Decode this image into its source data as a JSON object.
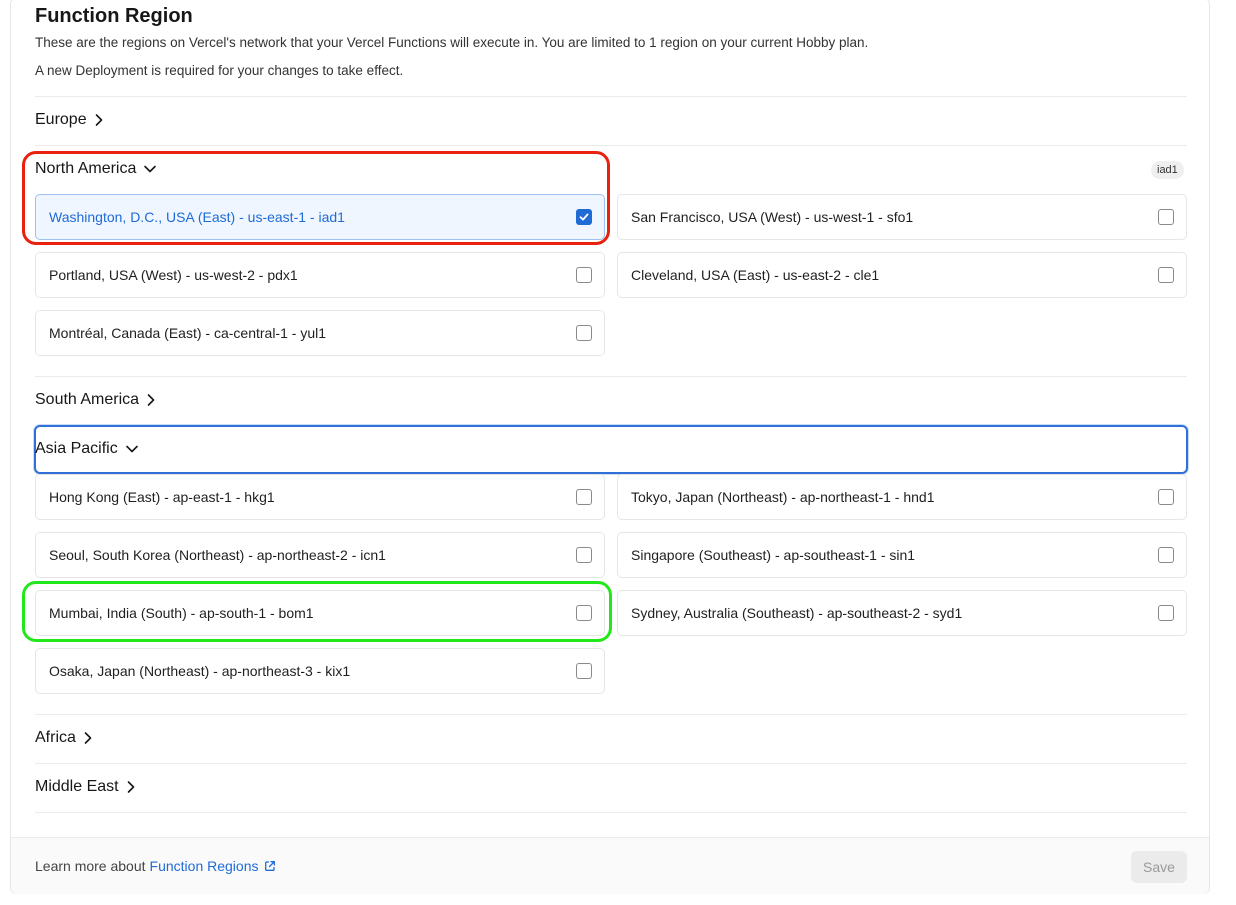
{
  "section": {
    "title": "Function Region",
    "description": "These are the regions on Vercel's network that your Vercel Functions will execute in. You are limited to 1 region on your current Hobby plan.",
    "note": "A new Deployment is required for your changes to take effect."
  },
  "groups": {
    "europe": {
      "label": "Europe",
      "expanded": false
    },
    "north_america": {
      "label": "North America",
      "expanded": true,
      "badge": "iad1",
      "options": [
        {
          "label": "Washington, D.C., USA (East) - us-east-1 - iad1",
          "checked": true
        },
        {
          "label": "San Francisco, USA (West) - us-west-1 - sfo1",
          "checked": false
        },
        {
          "label": "Portland, USA (West) - us-west-2 - pdx1",
          "checked": false
        },
        {
          "label": "Cleveland, USA (East) - us-east-2 - cle1",
          "checked": false
        },
        {
          "label": "Montréal, Canada (East) - ca-central-1 - yul1",
          "checked": false
        }
      ]
    },
    "south_america": {
      "label": "South America",
      "expanded": false
    },
    "asia_pacific": {
      "label": "Asia Pacific",
      "expanded": true,
      "options": [
        {
          "label": "Hong Kong (East) - ap-east-1 - hkg1",
          "checked": false
        },
        {
          "label": "Tokyo, Japan (Northeast) - ap-northeast-1 - hnd1",
          "checked": false
        },
        {
          "label": "Seoul, South Korea (Northeast) - ap-northeast-2 - icn1",
          "checked": false
        },
        {
          "label": "Singapore (Southeast) - ap-southeast-1 - sin1",
          "checked": false
        },
        {
          "label": "Mumbai, India (South) - ap-south-1 - bom1",
          "checked": false
        },
        {
          "label": "Sydney, Australia (Southeast) - ap-southeast-2 - syd1",
          "checked": false
        },
        {
          "label": "Osaka, Japan (Northeast) - ap-northeast-3 - kix1",
          "checked": false
        }
      ]
    },
    "africa": {
      "label": "Africa",
      "expanded": false
    },
    "middle_east": {
      "label": "Middle East",
      "expanded": false
    }
  },
  "footer": {
    "text": "Learn more about",
    "link": "Function Regions",
    "save_label": "Save"
  },
  "colors": {
    "accent": "#1f6bd6",
    "highlight_red": "#e8220f",
    "highlight_green": "#22e81b"
  },
  "icons": {
    "collapsed": "chevron-right-icon",
    "expanded": "chevron-down-icon",
    "checked": "check-icon",
    "external": "external-link-icon"
  }
}
